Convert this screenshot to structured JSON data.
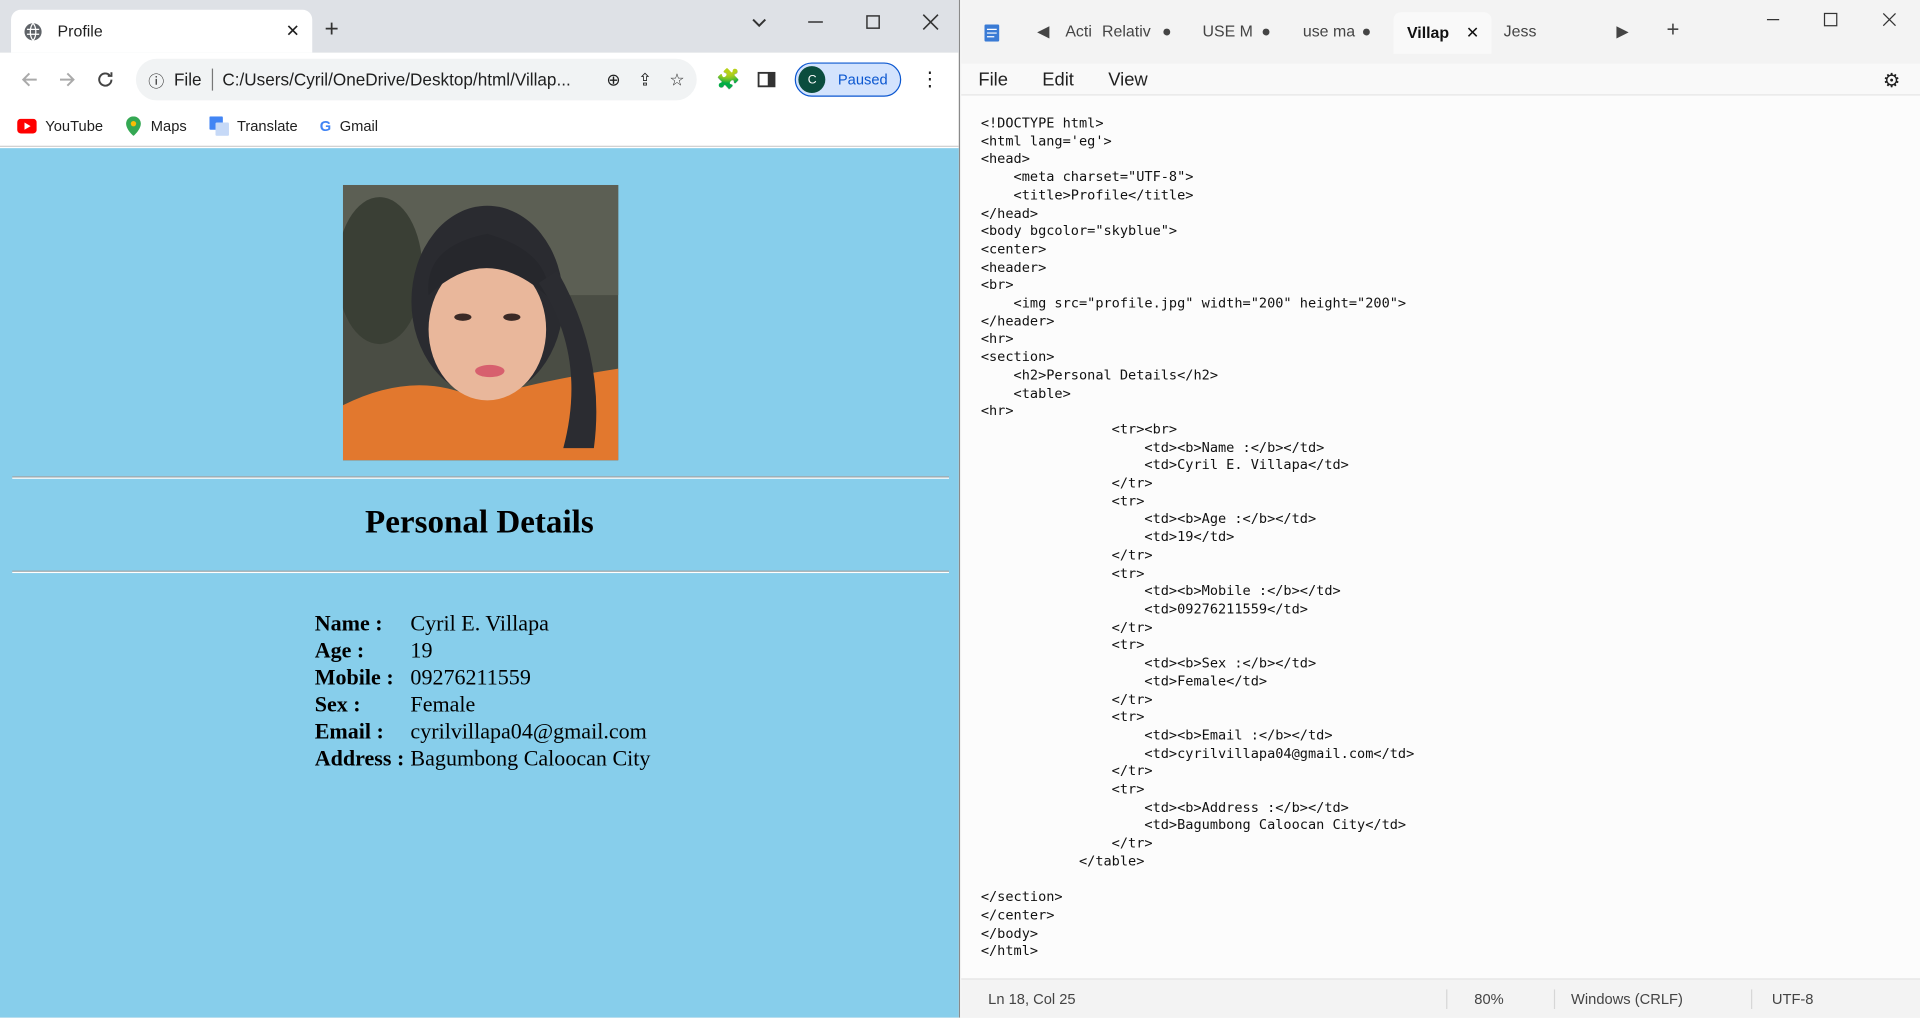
{
  "browser": {
    "tab_title": "Profile",
    "address": "C:/Users/Cyril/OneDrive/Desktop/html/Villap...",
    "file_label": "File",
    "profile_initial": "C",
    "profile_status": "Paused",
    "bookmarks": [
      {
        "label": "YouTube",
        "icon": "youtube-icon"
      },
      {
        "label": "Maps",
        "icon": "maps-icon"
      },
      {
        "label": "Translate",
        "icon": "translate-icon"
      },
      {
        "label": "Gmail",
        "icon": "gmail-icon"
      }
    ],
    "page_bg": "#87ceeb"
  },
  "profile": {
    "heading": "Personal Details",
    "rows": [
      {
        "label": "Name :",
        "value": "Cyril E. Villapa"
      },
      {
        "label": "Age :",
        "value": "19"
      },
      {
        "label": "Mobile :",
        "value": "09276211559"
      },
      {
        "label": "Sex :",
        "value": "Female"
      },
      {
        "label": "Email :",
        "value": "cyrilvillapa04@gmail.com"
      },
      {
        "label": "Address :",
        "value": "Bagumbong Caloocan City"
      }
    ]
  },
  "notepad": {
    "tabs": [
      "Acti",
      "Relativ",
      "USE M",
      "use ma",
      "Villap",
      "Jess"
    ],
    "active_tab": "Villap",
    "menu": [
      "File",
      "Edit",
      "View"
    ],
    "code": "<!DOCTYPE html>\n<html lang='eg'>\n<head>\n    <meta charset=\"UTF-8\">\n    <title>Profile</title>\n</head>\n<body bgcolor=\"skyblue\">\n<center>\n<header>\n<br>\n    <img src=\"profile.jpg\" width=\"200\" height=\"200\">\n</header>\n<hr>\n<section>\n    <h2>Personal Details</h2>\n    <table>\n<hr>\n                <tr><br>\n                    <td><b>Name :</b></td>\n                    <td>Cyril E. Villapa</td>\n                </tr>\n                <tr>\n                    <td><b>Age :</b></td>\n                    <td>19</td>\n                </tr>\n                <tr>\n                    <td><b>Mobile :</b></td>\n                    <td>09276211559</td>\n                </tr>\n                <tr>\n                    <td><b>Sex :</b></td>\n                    <td>Female</td>\n                </tr>\n                <tr>\n                    <td><b>Email :</b></td>\n                    <td>cyrilvillapa04@gmail.com</td>\n                </tr>\n                <tr>\n                    <td><b>Address :</b></td>\n                    <td>Bagumbong Caloocan City</td>\n                </tr>\n            </table>\n\n</section>\n</center>\n</body>\n</html>",
    "status": {
      "position": "Ln 18, Col 25",
      "zoom": "80%",
      "eol": "Windows (CRLF)",
      "encoding": "UTF-8"
    }
  }
}
